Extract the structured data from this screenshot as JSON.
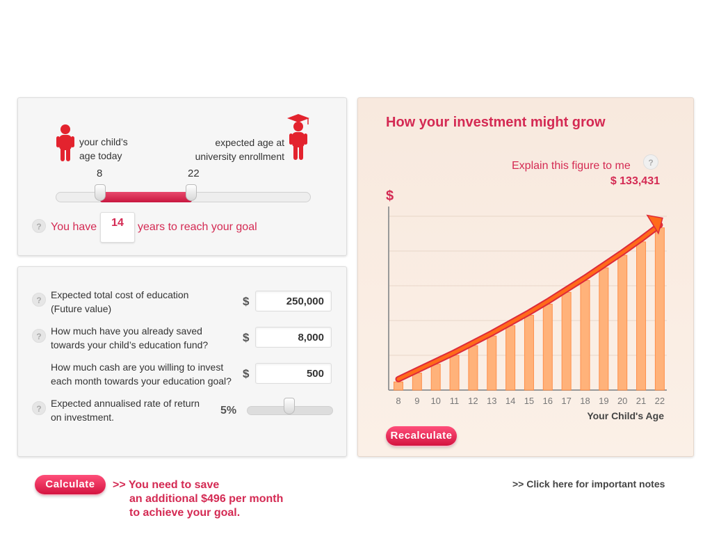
{
  "age_panel": {
    "child_age_label_1": "your child’s",
    "child_age_label_2": "age today",
    "enroll_label_1": "expected age at",
    "enroll_label_2": "university enrollment",
    "child_age_value": "8",
    "enroll_age_value": "22",
    "you_have": "You have",
    "years_value": "14",
    "years_suffix": "years to reach your goal",
    "help": "?"
  },
  "inputs_panel": {
    "cost_label_1": "Expected total cost of education",
    "cost_label_2": "(Future value)",
    "cost_value": "250,000",
    "saved_label_1": "How much have you already saved",
    "saved_label_2": "towards your child’s education fund?",
    "saved_value": "8,000",
    "monthly_label_1": "How much cash are you willing to invest",
    "monthly_label_2": "each month towards your education goal?",
    "monthly_value": "500",
    "rate_label_1": "Expected annualised rate of return",
    "rate_label_2": "on investment.",
    "rate_value": "5%",
    "currency": "$",
    "help": "?"
  },
  "chart_panel": {
    "title": "How your investment might grow",
    "explain": "Explain this figure to me",
    "help": "?",
    "final_value": "$ 133,431",
    "recalculate": "Recalculate"
  },
  "chart_data": {
    "type": "bar",
    "ylabel": "$",
    "xlabel": "Your Child's Age",
    "categories": [
      "8",
      "9",
      "10",
      "11",
      "12",
      "13",
      "14",
      "15",
      "16",
      "17",
      "18",
      "19",
      "20",
      "21",
      "22"
    ],
    "values": [
      5.5,
      11.5,
      17.5,
      23.5,
      30,
      36.5,
      43.5,
      50.5,
      58,
      66,
      74,
      82.5,
      91,
      100,
      109.5
    ],
    "ylim": [
      0,
      122
    ],
    "grid": true,
    "colors": {
      "bar": "#ffb27a",
      "bar_edge": "#ff8f4a",
      "arrow_dark": "#dd2a3a",
      "arrow_light": "#ff6a1a"
    }
  },
  "footer": {
    "calculate": "Calculate",
    "message_1": ">> You need to save",
    "message_2": "an additional $496 per month",
    "message_3": "to achieve your goal.",
    "notes_link": ">> Click here for important notes"
  },
  "colors": {
    "accent": "#d42a53",
    "figure": "#e3232e"
  }
}
